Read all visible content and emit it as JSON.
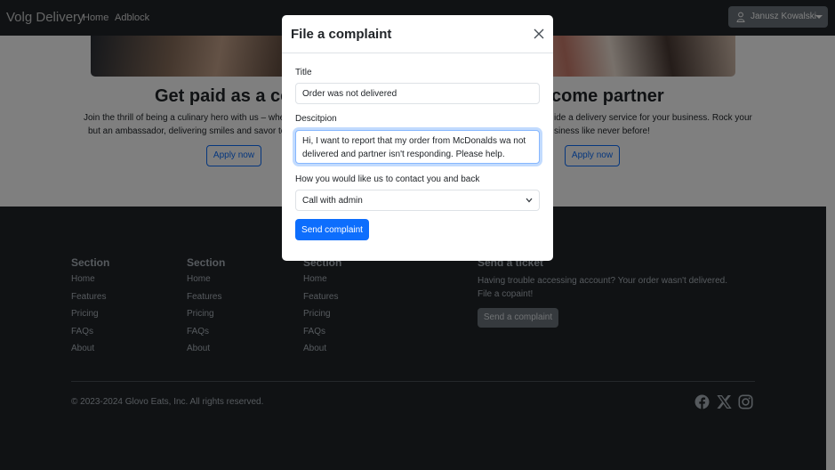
{
  "navbar": {
    "brand": "Volg Delivery",
    "links": [
      "Home",
      "Adblock"
    ],
    "user": {
      "name": "Janusz Kowalski",
      "icon": "person-icon"
    }
  },
  "hero": {
    "cards": [
      {
        "title": "Get paid as a cou",
        "text_lines": [
          "Join the thrill of being a culinary hero with us – wher",
          "but an ambassador, delivering smiles and savor to"
        ],
        "button": "Apply now"
      },
      {
        "title": "come partner",
        "text_lines": [
          "ide a delivery service for your business. Rock your",
          "siness like never before!"
        ],
        "button": "Apply now"
      }
    ]
  },
  "footer": {
    "columns": [
      {
        "heading": "Section",
        "links": [
          "Home",
          "Features",
          "Pricing",
          "FAQs",
          "About"
        ]
      },
      {
        "heading": "Section",
        "links": [
          "Home",
          "Features",
          "Pricing",
          "FAQs",
          "About"
        ]
      },
      {
        "heading": "Section",
        "links": [
          "Home",
          "Features",
          "Pricing",
          "FAQs",
          "About"
        ]
      }
    ],
    "ticket": {
      "heading": "Send a ticket",
      "text_lines": [
        "Having trouble accessing account? Your order wasn't delivered.",
        "File a copaint!"
      ],
      "button": "Send a complaint"
    },
    "copyright": "© 2023-2024 Glovo Eats, Inc. All rights reserved.",
    "social_icons": [
      "facebook-icon",
      "x-icon",
      "instagram-icon"
    ]
  },
  "modal": {
    "title": "File a complaint",
    "title_field": {
      "label": "Title",
      "value": "Order was not delivered"
    },
    "description_field": {
      "label": "Descitpion",
      "value": "Hi, I want to report that my order from McDonalds wa not delivered and partner isn't responding. Please help."
    },
    "contact_field": {
      "label": "How you would like us to contact you and back",
      "selected": "Call with admin"
    },
    "submit": "Send complaint"
  },
  "colors": {
    "navbar_bg": "#212529",
    "footer_bg": "#212529",
    "primary": "#0d6efd",
    "secondary": "#6c757d"
  }
}
